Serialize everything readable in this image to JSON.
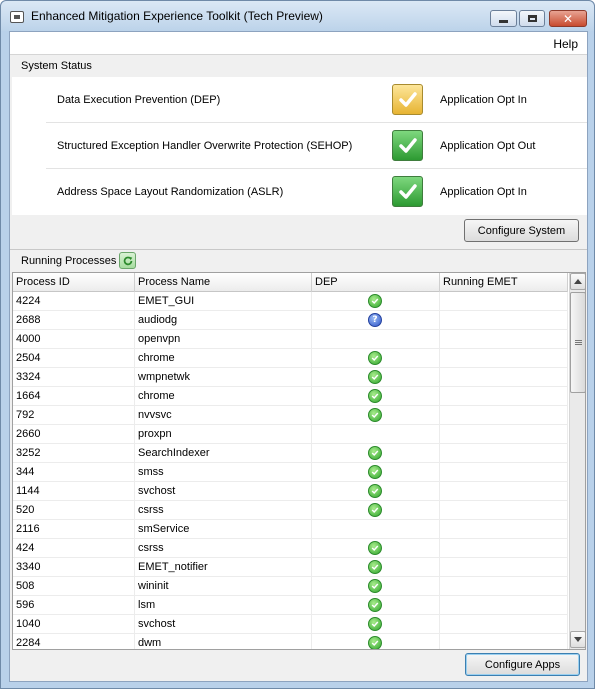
{
  "window": {
    "title": "Enhanced Mitigation Experience Toolkit (Tech Preview)"
  },
  "menu": {
    "help": "Help"
  },
  "system_status": {
    "label": "System Status",
    "rows": [
      {
        "name": "Data Execution Prevention (DEP)",
        "icon": "check-icon",
        "icon_color": "#e7b433",
        "value": "Application Opt In"
      },
      {
        "name": "Structured Exception Handler Overwrite Protection (SEHOP)",
        "icon": "check-icon",
        "icon_color": "#2d9a32",
        "value": "Application Opt Out"
      },
      {
        "name": "Address Space Layout Randomization (ASLR)",
        "icon": "check-icon",
        "icon_color": "#2d9a32",
        "value": "Application Opt In"
      }
    ],
    "configure_button": "Configure System"
  },
  "running_processes": {
    "label": "Running Processes",
    "columns": [
      "Process ID",
      "Process Name",
      "DEP",
      "Running EMET"
    ],
    "rows": [
      {
        "pid": "4224",
        "name": "EMET_GUI",
        "dep": "ok"
      },
      {
        "pid": "2688",
        "name": "audiodg",
        "dep": "unknown"
      },
      {
        "pid": "4000",
        "name": "openvpn",
        "dep": ""
      },
      {
        "pid": "2504",
        "name": "chrome",
        "dep": "ok"
      },
      {
        "pid": "3324",
        "name": "wmpnetwk",
        "dep": "ok"
      },
      {
        "pid": "1664",
        "name": "chrome",
        "dep": "ok"
      },
      {
        "pid": "792",
        "name": "nvvsvc",
        "dep": "ok"
      },
      {
        "pid": "2660",
        "name": "proxpn",
        "dep": ""
      },
      {
        "pid": "3252",
        "name": "SearchIndexer",
        "dep": "ok"
      },
      {
        "pid": "344",
        "name": "smss",
        "dep": "ok"
      },
      {
        "pid": "1144",
        "name": "svchost",
        "dep": "ok"
      },
      {
        "pid": "520",
        "name": "csrss",
        "dep": "ok"
      },
      {
        "pid": "2116",
        "name": "smService",
        "dep": ""
      },
      {
        "pid": "424",
        "name": "csrss",
        "dep": "ok"
      },
      {
        "pid": "3340",
        "name": "EMET_notifier",
        "dep": "ok"
      },
      {
        "pid": "508",
        "name": "wininit",
        "dep": "ok"
      },
      {
        "pid": "596",
        "name": "lsm",
        "dep": "ok"
      },
      {
        "pid": "1040",
        "name": "svchost",
        "dep": "ok"
      },
      {
        "pid": "2284",
        "name": "dwm",
        "dep": "ok"
      }
    ],
    "configure_button": "Configure Apps"
  },
  "colors": {
    "accent": "#3c7fb1",
    "ok": "#2fa52c",
    "unknown": "#2b52c7"
  }
}
